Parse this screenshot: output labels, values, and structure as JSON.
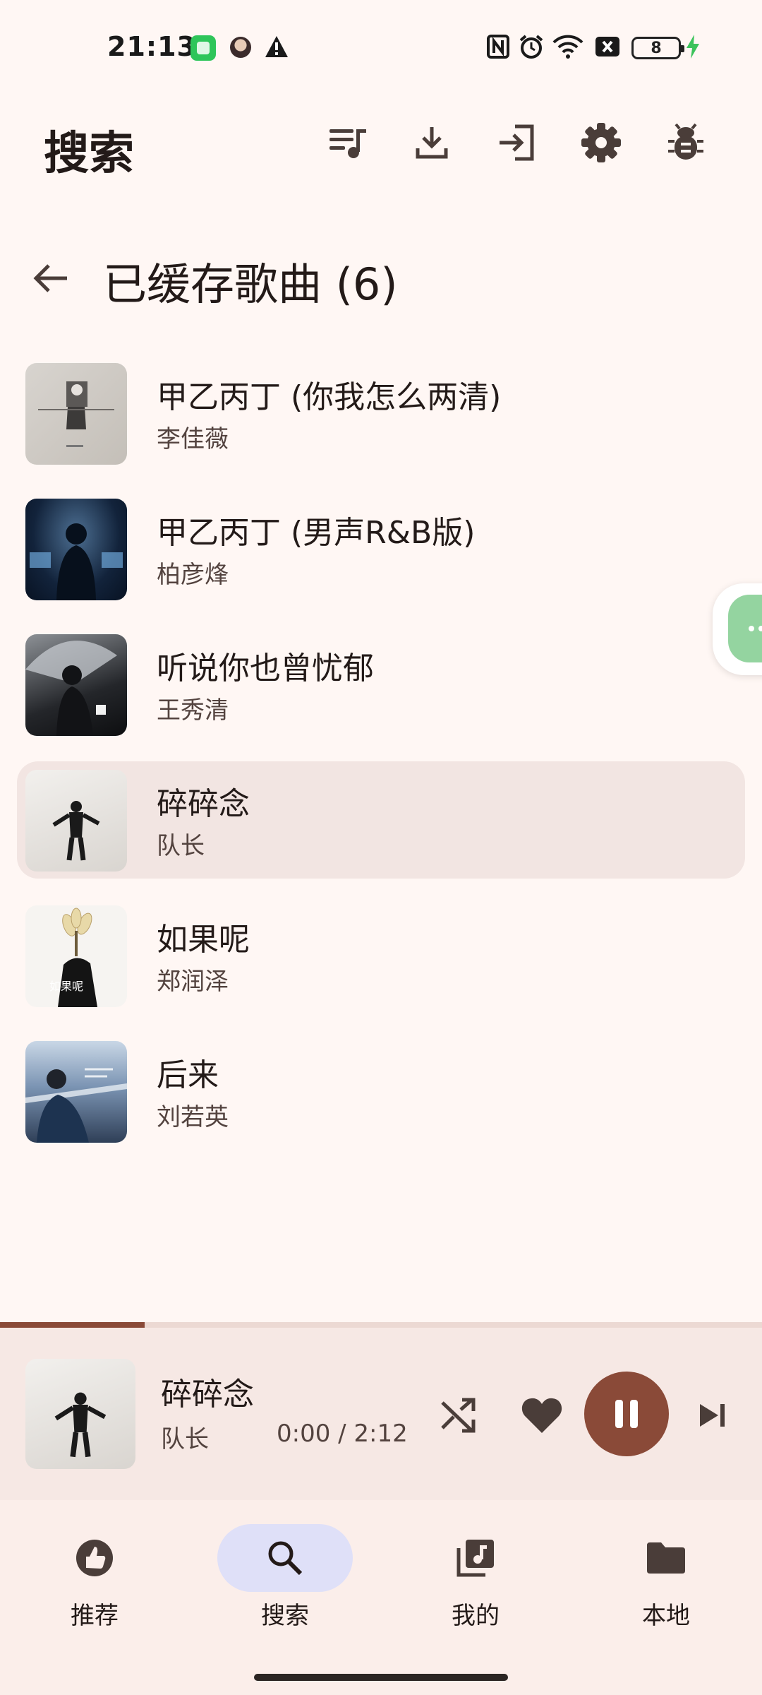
{
  "status_bar": {
    "time": "21:13",
    "battery_level": "8",
    "icons": [
      "app-notification-icon",
      "avatar-notification-icon",
      "warning-icon",
      "nfc-icon",
      "alarm-icon",
      "wifi-icon",
      "no-sim-icon",
      "battery-icon",
      "charging-icon"
    ]
  },
  "top_bar": {
    "title": "搜索",
    "actions": [
      "queue-music-icon",
      "download-icon",
      "login-icon",
      "settings-icon",
      "bug-icon"
    ]
  },
  "section": {
    "title": "已缓存歌曲 (6)",
    "back_icon": "arrow-back-icon"
  },
  "songs": [
    {
      "title": "甲乙丙丁 (你我怎么两清)",
      "artist": "李佳薇"
    },
    {
      "title": "甲乙丙丁 (男声R&B版)",
      "artist": "柏彦烽"
    },
    {
      "title": "听说你也曾忧郁",
      "artist": "王秀清"
    },
    {
      "title": "碎碎念",
      "artist": "队长",
      "active": true
    },
    {
      "title": "如果呢",
      "artist": "郑润泽"
    },
    {
      "title": "后来",
      "artist": "刘若英"
    }
  ],
  "player": {
    "title": "碎碎念",
    "artist": "队长",
    "time": "0:00 / 2:12",
    "progress": 0.19,
    "controls": [
      "shuffle-icon",
      "heart-icon",
      "pause-icon",
      "skip-next-icon"
    ]
  },
  "nav": {
    "items": [
      {
        "label": "推荐",
        "icon": "recommend-icon"
      },
      {
        "label": "搜索",
        "icon": "search-icon",
        "selected": true
      },
      {
        "label": "我的",
        "icon": "library-music-icon"
      },
      {
        "label": "本地",
        "icon": "folder-icon"
      }
    ]
  },
  "colors": {
    "background": "#fff7f4",
    "accent": "#8a4a38",
    "active_row": "#f2e5e2",
    "nav_selected": "#dfe0f8",
    "icon": "#4a3d39"
  }
}
